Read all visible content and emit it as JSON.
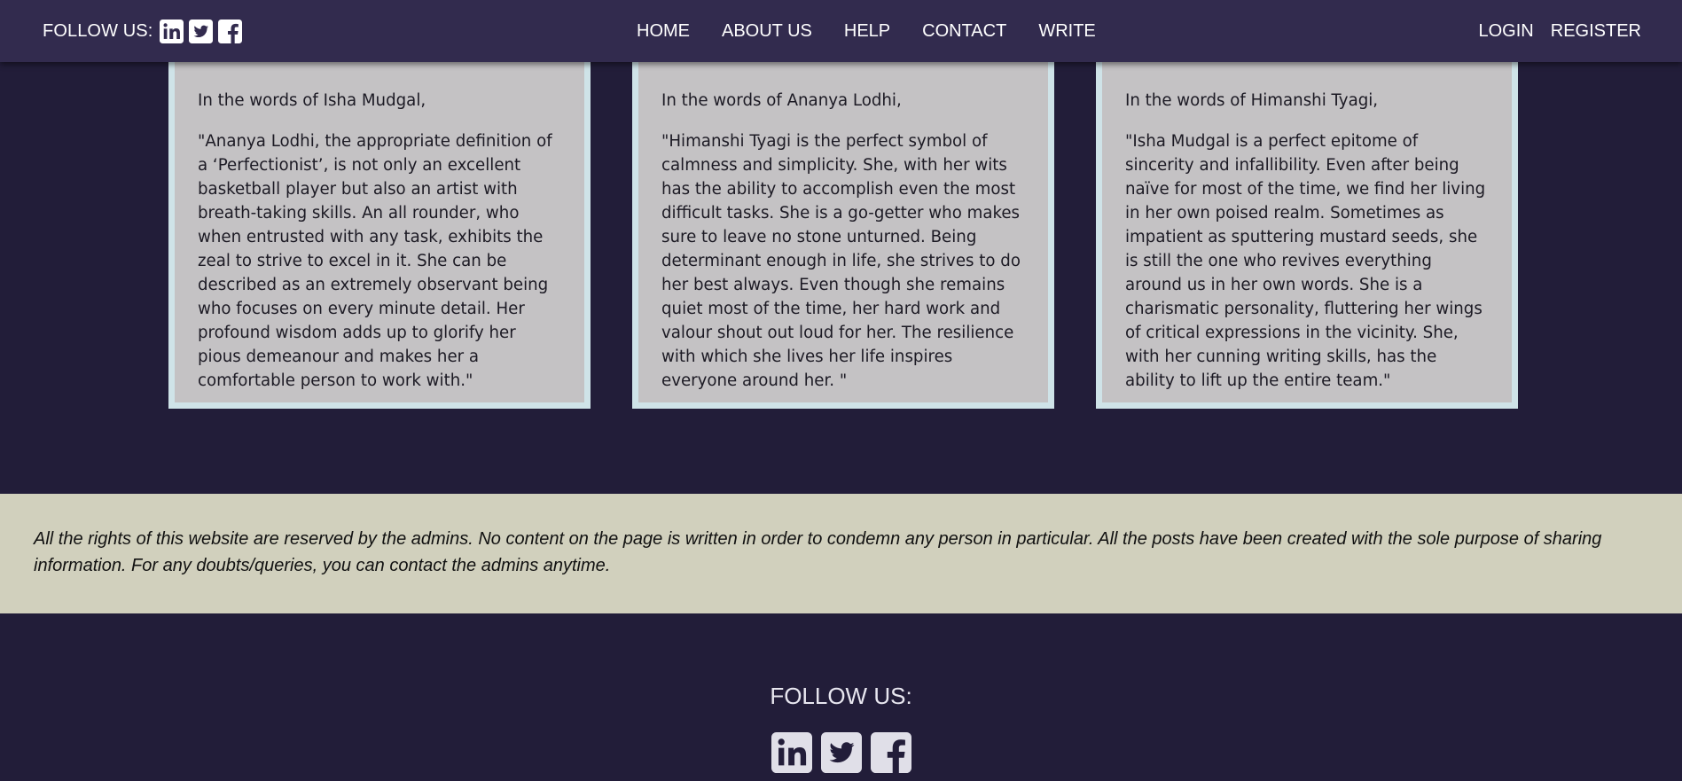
{
  "header": {
    "follow_label": "FOLLOW US:",
    "social_icons": [
      "linkedin-icon",
      "twitter-icon",
      "facebook-icon"
    ],
    "nav": [
      "HOME",
      "ABOUT US",
      "HELP",
      "CONTACT",
      "WRITE"
    ],
    "auth": [
      "LOGIN",
      "REGISTER"
    ]
  },
  "testimonials": [
    {
      "intro": "In the words of Isha Mudgal,",
      "quote": "\"Ananya Lodhi, the appropriate definition of a ‘Perfectionist’, is not only an excellent basketball player but also an artist with breath-taking skills. An all rounder, who when entrusted with any task, exhibits the zeal to strive to excel in it. She can be described as an extremely observant being who focuses on every minute detail. Her profound wisdom adds up to glorify her pious demeanour and makes her a comfortable person to work with.\""
    },
    {
      "intro": "In the words of Ananya Lodhi,",
      "quote": "\"Himanshi Tyagi is the perfect symbol of calmness and simplicity. She, with her wits has the ability to accomplish even the most difficult tasks. She is a go-getter who makes sure to leave no stone unturned. Being determinant enough in life, she strives to do her best always. Even though she remains quiet most of the time, her hard work and valour shout out loud for her. The resilience with which she lives her life inspires everyone around her. \""
    },
    {
      "intro": "In the words of Himanshi Tyagi,",
      "quote": "\"Isha Mudgal is a perfect epitome of sincerity and infallibility. Even after being naïve for most of the time, we find her living in her own poised realm. Sometimes as impatient as sputtering mustard seeds, she is still the one who revives everything around us in her own words. She is a charismatic personality, fluttering her wings of critical expressions in the vicinity. She, with her cunning writing skills, has the ability to lift up the entire team.\""
    }
  ],
  "disclaimer": "All the rights of this website are reserved by the admins. No content on the page is written in order to condemn any person in particular. All the posts have been created with the sole purpose of sharing information. For any doubts/queries, you can contact the admins anytime.",
  "footer": {
    "follow_label": "FOLLOW US:",
    "social_icons": [
      "linkedin-icon",
      "twitter-icon",
      "facebook-icon"
    ]
  },
  "colors": {
    "navbar": "#322b4e",
    "background": "#221d39",
    "card": "#c4c2c4",
    "card_border": "#cfe3e8",
    "disclaimer_band": "#d1d0bd"
  }
}
